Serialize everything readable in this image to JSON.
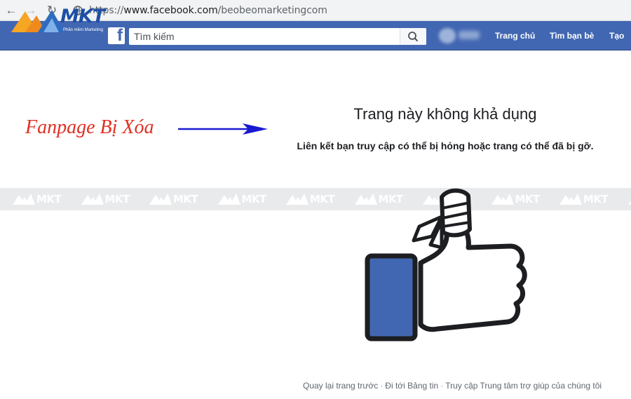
{
  "browser": {
    "url_prefix": "https://",
    "url_host": "www.facebook.com",
    "url_path": "/beobeomarketingcom"
  },
  "logo": {
    "text": "MKT",
    "tagline": "Phần mềm Marketing"
  },
  "fb_header": {
    "logo_letter": "f",
    "search_placeholder": "Tìm kiếm",
    "nav": {
      "home": "Trang chủ",
      "find_friends": "Tìm bạn bè",
      "create": "Tạo"
    }
  },
  "content": {
    "title": "Trang này không khả dụng",
    "subtitle": "Liên kết bạn truy cập có thể bị hỏng hoặc trang có thể đã bị gỡ.",
    "annotation": "Fanpage Bị Xóa"
  },
  "watermark": {
    "text": "MKT",
    "count": 10
  },
  "footer": {
    "back": "Quay lại trang trước",
    "news_feed": "Đi tới Bảng tin",
    "help_center": "Truy cập Trung tâm trợ giúp của chúng tôi",
    "separator": "·"
  },
  "colors": {
    "fb_blue": "#4267b2",
    "annotation_red": "#e03024",
    "arrow_blue": "#1a1ad1",
    "thumb_sleeve": "#4267b2"
  }
}
